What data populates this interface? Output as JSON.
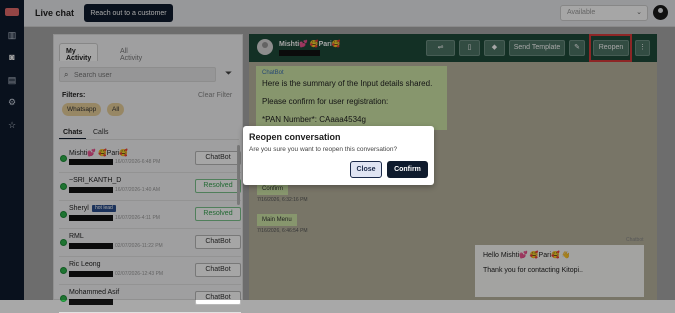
{
  "topbar": {
    "title": "Live chat",
    "reach_button": "Reach out to a customer",
    "status": "Available"
  },
  "left": {
    "tabs": [
      "My Activity",
      "All Activity"
    ],
    "search_placeholder": "Search user",
    "filters_label": "Filters:",
    "clear_filter": "Clear Filter",
    "chips": [
      "Whatsapp",
      "All"
    ],
    "subtabs": [
      "Chats",
      "Calls"
    ],
    "chats": [
      {
        "name": "Mishti💕 🥰Pari🥰",
        "date": "16/07/2026-6:48 PM",
        "status": "ChatBot"
      },
      {
        "name": "~SRI_KANTH_D",
        "date": "16/07/2026-1:40 AM",
        "status": "Resolved"
      },
      {
        "name": "Sheryl",
        "tag": "hot lead",
        "date": "16/07/2026-4:11 PM",
        "status": "Resolved"
      },
      {
        "name": "RML",
        "date": "02/07/2026-11:22 PM",
        "status": "ChatBot"
      },
      {
        "name": "Ric Leong",
        "date": "02/07/2026-12:43 PM",
        "status": "ChatBot"
      },
      {
        "name": "Mohammed Asif",
        "date": "",
        "status": "ChatBot"
      }
    ]
  },
  "chat": {
    "contact_name": "Mishti💕 🥰Pari🥰",
    "header_buttons": {
      "send_template": "Send Template",
      "reopen": "Reopen"
    },
    "bot_label": "ChatBot",
    "bot_lines": [
      "Here is the summary of the Input details shared.",
      "Please confirm for user registration:",
      "*PAN Number*: CAaaa4534g"
    ],
    "confirm_msg": "Confirm",
    "confirm_time": "7/16/2026, 6:32:16 PM",
    "menu_msg": "Main Menu",
    "menu_time": "7/16/2026, 6:46:54 PM",
    "chatbot_sender": "Chatbot",
    "incoming_l1": "Hello Mishti💕 🥰Pari🥰 👋",
    "incoming_l2": "Thank you for contacting Kitopi.."
  },
  "modal": {
    "title": "Reopen conversation",
    "text": "Are you sure you want to reopen this conversation?",
    "close": "Close",
    "confirm": "Confirm"
  },
  "colors": {
    "nav": "#0f1b2d",
    "chat_header": "#1e4a3a",
    "highlight": "#d93b3b",
    "bot_bubble": "#cfe6a8"
  }
}
